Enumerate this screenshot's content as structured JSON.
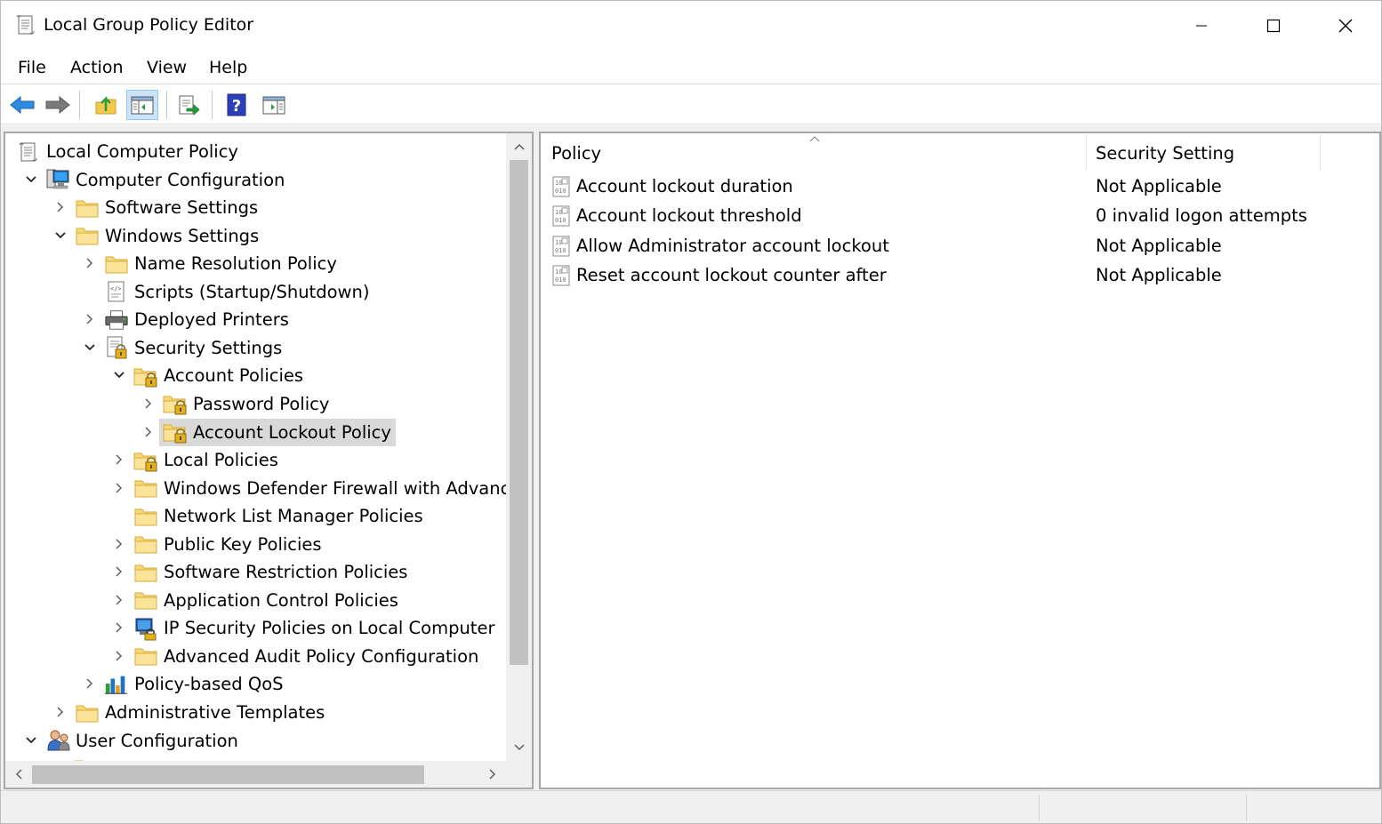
{
  "window": {
    "title": "Local Group Policy Editor"
  },
  "menu": [
    "File",
    "Action",
    "View",
    "Help"
  ],
  "toolbar": {
    "buttons": [
      "back-arrow-icon",
      "forward-arrow-icon",
      "up-folder-icon",
      "show-hide-tree-icon",
      "export-list-icon",
      "help-icon",
      "show-hide-action-pane-icon"
    ],
    "active": "show-hide-tree-icon"
  },
  "tree": {
    "items": [
      {
        "label": "Local Computer Policy",
        "icon": "policy-scroll-icon",
        "expander": "none"
      },
      {
        "label": "Computer Configuration",
        "icon": "computer-icon",
        "expander": "expanded"
      },
      {
        "label": "Software Settings",
        "icon": "folder-icon",
        "expander": "collapsed"
      },
      {
        "label": "Windows Settings",
        "icon": "folder-icon",
        "expander": "expanded"
      },
      {
        "label": "Name Resolution Policy",
        "icon": "folder-icon",
        "expander": "collapsed"
      },
      {
        "label": "Scripts (Startup/Shutdown)",
        "icon": "script-icon",
        "expander": "none"
      },
      {
        "label": "Deployed Printers",
        "icon": "printer-icon",
        "expander": "collapsed"
      },
      {
        "label": "Security Settings",
        "icon": "security-settings-icon",
        "expander": "expanded"
      },
      {
        "label": "Account Policies",
        "icon": "locked-folder-icon",
        "expander": "expanded"
      },
      {
        "label": "Password Policy",
        "icon": "locked-folder-icon",
        "expander": "collapsed"
      },
      {
        "label": "Account Lockout Policy",
        "icon": "locked-folder-icon",
        "expander": "collapsed",
        "selected": true
      },
      {
        "label": "Local Policies",
        "icon": "locked-folder-icon",
        "expander": "collapsed"
      },
      {
        "label": "Windows Defender Firewall with Advanced",
        "icon": "folder-icon",
        "expander": "collapsed"
      },
      {
        "label": "Network List Manager Policies",
        "icon": "folder-icon",
        "expander": "none"
      },
      {
        "label": "Public Key Policies",
        "icon": "folder-icon",
        "expander": "collapsed"
      },
      {
        "label": "Software Restriction Policies",
        "icon": "folder-icon",
        "expander": "collapsed"
      },
      {
        "label": "Application Control Policies",
        "icon": "folder-icon",
        "expander": "collapsed"
      },
      {
        "label": "IP Security Policies on Local Computer",
        "icon": "ip-security-icon",
        "expander": "collapsed"
      },
      {
        "label": "Advanced Audit Policy Configuration",
        "icon": "folder-icon",
        "expander": "collapsed"
      },
      {
        "label": "Policy-based QoS",
        "icon": "qos-chart-icon",
        "expander": "collapsed"
      },
      {
        "label": "Administrative Templates",
        "icon": "folder-icon",
        "expander": "collapsed"
      },
      {
        "label": "User Configuration",
        "icon": "user-icon",
        "expander": "expanded"
      }
    ]
  },
  "list": {
    "columns": [
      "Policy",
      "Security Setting"
    ],
    "rows": [
      {
        "policy": "Account lockout duration",
        "setting": "Not Applicable"
      },
      {
        "policy": "Account lockout threshold",
        "setting": "0 invalid logon attempts"
      },
      {
        "policy": "Allow Administrator account lockout",
        "setting": "Not Applicable"
      },
      {
        "policy": "Reset account lockout counter after",
        "setting": "Not Applicable"
      }
    ]
  },
  "colors": {
    "selection": "#dadada",
    "folder": "#f5d67a",
    "accent_blue": "#1e73c7"
  }
}
